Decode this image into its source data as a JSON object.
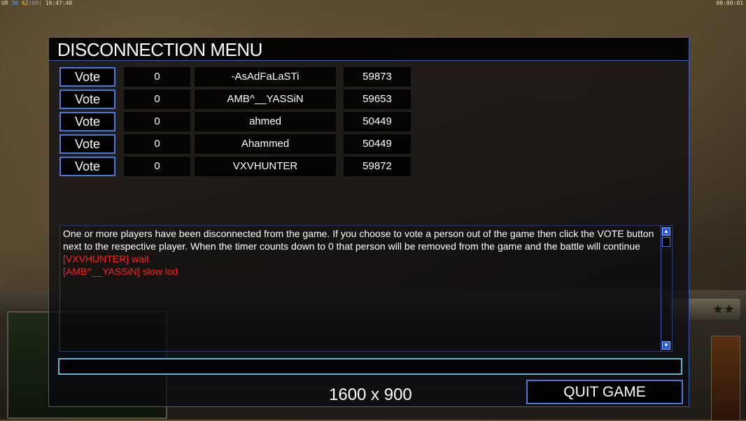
{
  "hud": {
    "left_prefix": "UR",
    "fps_a": "30",
    "fps_b": "62",
    "fps_c": "60",
    "clock": "19:47:40",
    "timer": "00:00:01"
  },
  "dialog": {
    "title": "DISCONNECTION MENU",
    "players": [
      {
        "vote_label": "Vote",
        "votes": "0",
        "name": "-AsAdFaLaSTi",
        "ping": "59873"
      },
      {
        "vote_label": "Vote",
        "votes": "0",
        "name": "AMB^__YASSiN",
        "ping": "59653"
      },
      {
        "vote_label": "Vote",
        "votes": "0",
        "name": "ahmed",
        "ping": "50449"
      },
      {
        "vote_label": "Vote",
        "votes": "0",
        "name": "Ahammed",
        "ping": "50449"
      },
      {
        "vote_label": "Vote",
        "votes": "0",
        "name": "VXVHUNTER",
        "ping": "59872"
      }
    ],
    "info_text": "One or more players have been disconnected from the game. If you choose to vote a person out of the game then click the VOTE button next to the respective player. When the timer counts down to 0 that person will be removed from the game and the battle will continue",
    "chat": [
      "[VXVHUNTER] wait",
      "[AMB^__YASSiN] slow lod"
    ],
    "chat_input_value": "",
    "resolution": "1600 x 900",
    "quit_label": "QUIT GAME"
  },
  "colors": {
    "accent_border": "#4a78e0",
    "chat_red": "#ff2020",
    "input_border": "#6ab0d0"
  }
}
